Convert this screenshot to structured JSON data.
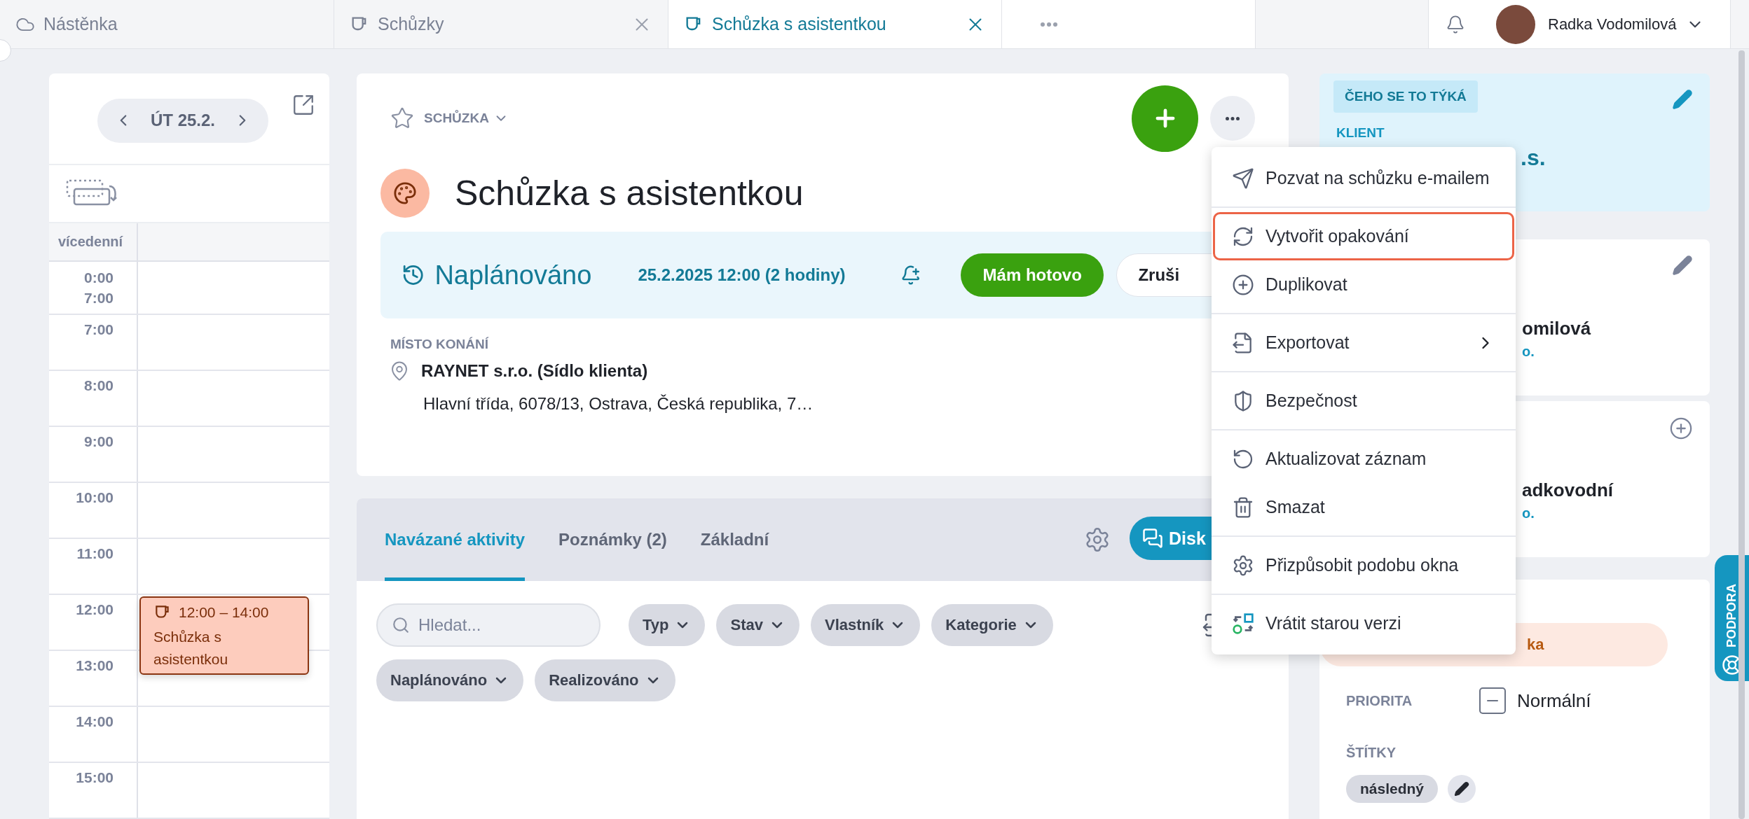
{
  "tabs": [
    {
      "label": "Nástěnka",
      "selected": false,
      "closable": false
    },
    {
      "label": "Schůzky",
      "selected": false,
      "closable": true
    },
    {
      "label": "Schůzka s asistentkou",
      "selected": true,
      "closable": true
    }
  ],
  "user": {
    "name": "Radka Vodomilová"
  },
  "calendar": {
    "date": "ÚT 25.2.",
    "multi_day_label": "vícedenní",
    "first_row": [
      "0:00",
      "7:00"
    ],
    "hours": [
      "7:00",
      "8:00",
      "9:00",
      "10:00",
      "11:00",
      "12:00",
      "13:00",
      "14:00",
      "15:00"
    ],
    "event": {
      "time": "12:00 – 14:00",
      "title": "Schůzka s asistentkou"
    }
  },
  "record": {
    "type_label": "SCHŮZKA",
    "favorite": false,
    "title": "Schůzka s asistentkou",
    "status": "Naplánováno",
    "datetime": "25.2.2025 12:00 (2 hodiny)",
    "buttons": [
      {
        "label": "Mám hotovo",
        "kind": "primary"
      },
      {
        "label": "Zruši",
        "kind": "secondary"
      }
    ],
    "location": {
      "label": "MÍSTO KONÁNÍ",
      "name": "RAYNET s.r.o. (Sídlo klienta)",
      "address": "Hlavní třída, 6078/13, Ostrava, Česká republika, 7…"
    }
  },
  "activity_tabs": [
    {
      "label": "Navázané aktivity",
      "selected": true
    },
    {
      "label": "Poznámky (2)",
      "selected": false
    },
    {
      "label": "Základní",
      "selected": false
    }
  ],
  "discuss_button": "Disk",
  "search": {
    "placeholder": "Hledat..."
  },
  "filters": [
    [
      "Typ",
      "Stav",
      "Vlastník",
      "Kategorie"
    ],
    [
      "Naplánováno",
      "Realizováno"
    ]
  ],
  "menu": [
    [
      {
        "label": "Pozvat na schůzku e-mailem",
        "highlighted": false,
        "submenu": false
      }
    ],
    [
      {
        "label": "Vytvořit opakování",
        "highlighted": true,
        "submenu": false
      },
      {
        "label": "Duplikovat",
        "highlighted": false,
        "submenu": false
      }
    ],
    [
      {
        "label": "Exportovat",
        "highlighted": false,
        "submenu": true
      }
    ],
    [
      {
        "label": "Bezpečnost",
        "highlighted": false,
        "submenu": false
      }
    ],
    [
      {
        "label": "Aktualizovat záznam",
        "highlighted": false,
        "submenu": false
      },
      {
        "label": "Smazat",
        "highlighted": false,
        "submenu": false
      }
    ],
    [
      {
        "label": "Přizpůsobit podobu okna",
        "highlighted": false,
        "submenu": false
      }
    ],
    [
      {
        "label": "Vrátit starou verzi",
        "highlighted": false,
        "submenu": false
      }
    ]
  ],
  "related": {
    "section_label": "ČEHO SE TO TÝKÁ",
    "client_label": "KLIENT",
    "client_value": ".s."
  },
  "people": [
    {
      "name": "omilová",
      "sub": "o."
    },
    {
      "name": "adkovodní",
      "sub": "o."
    }
  ],
  "details": {
    "status_pill": "ka",
    "priority_label": "PRIORITA",
    "priority": "Normální",
    "tags_label": "ŠTÍTKY",
    "tags": [
      "následný"
    ]
  },
  "support": "PODPORA"
}
